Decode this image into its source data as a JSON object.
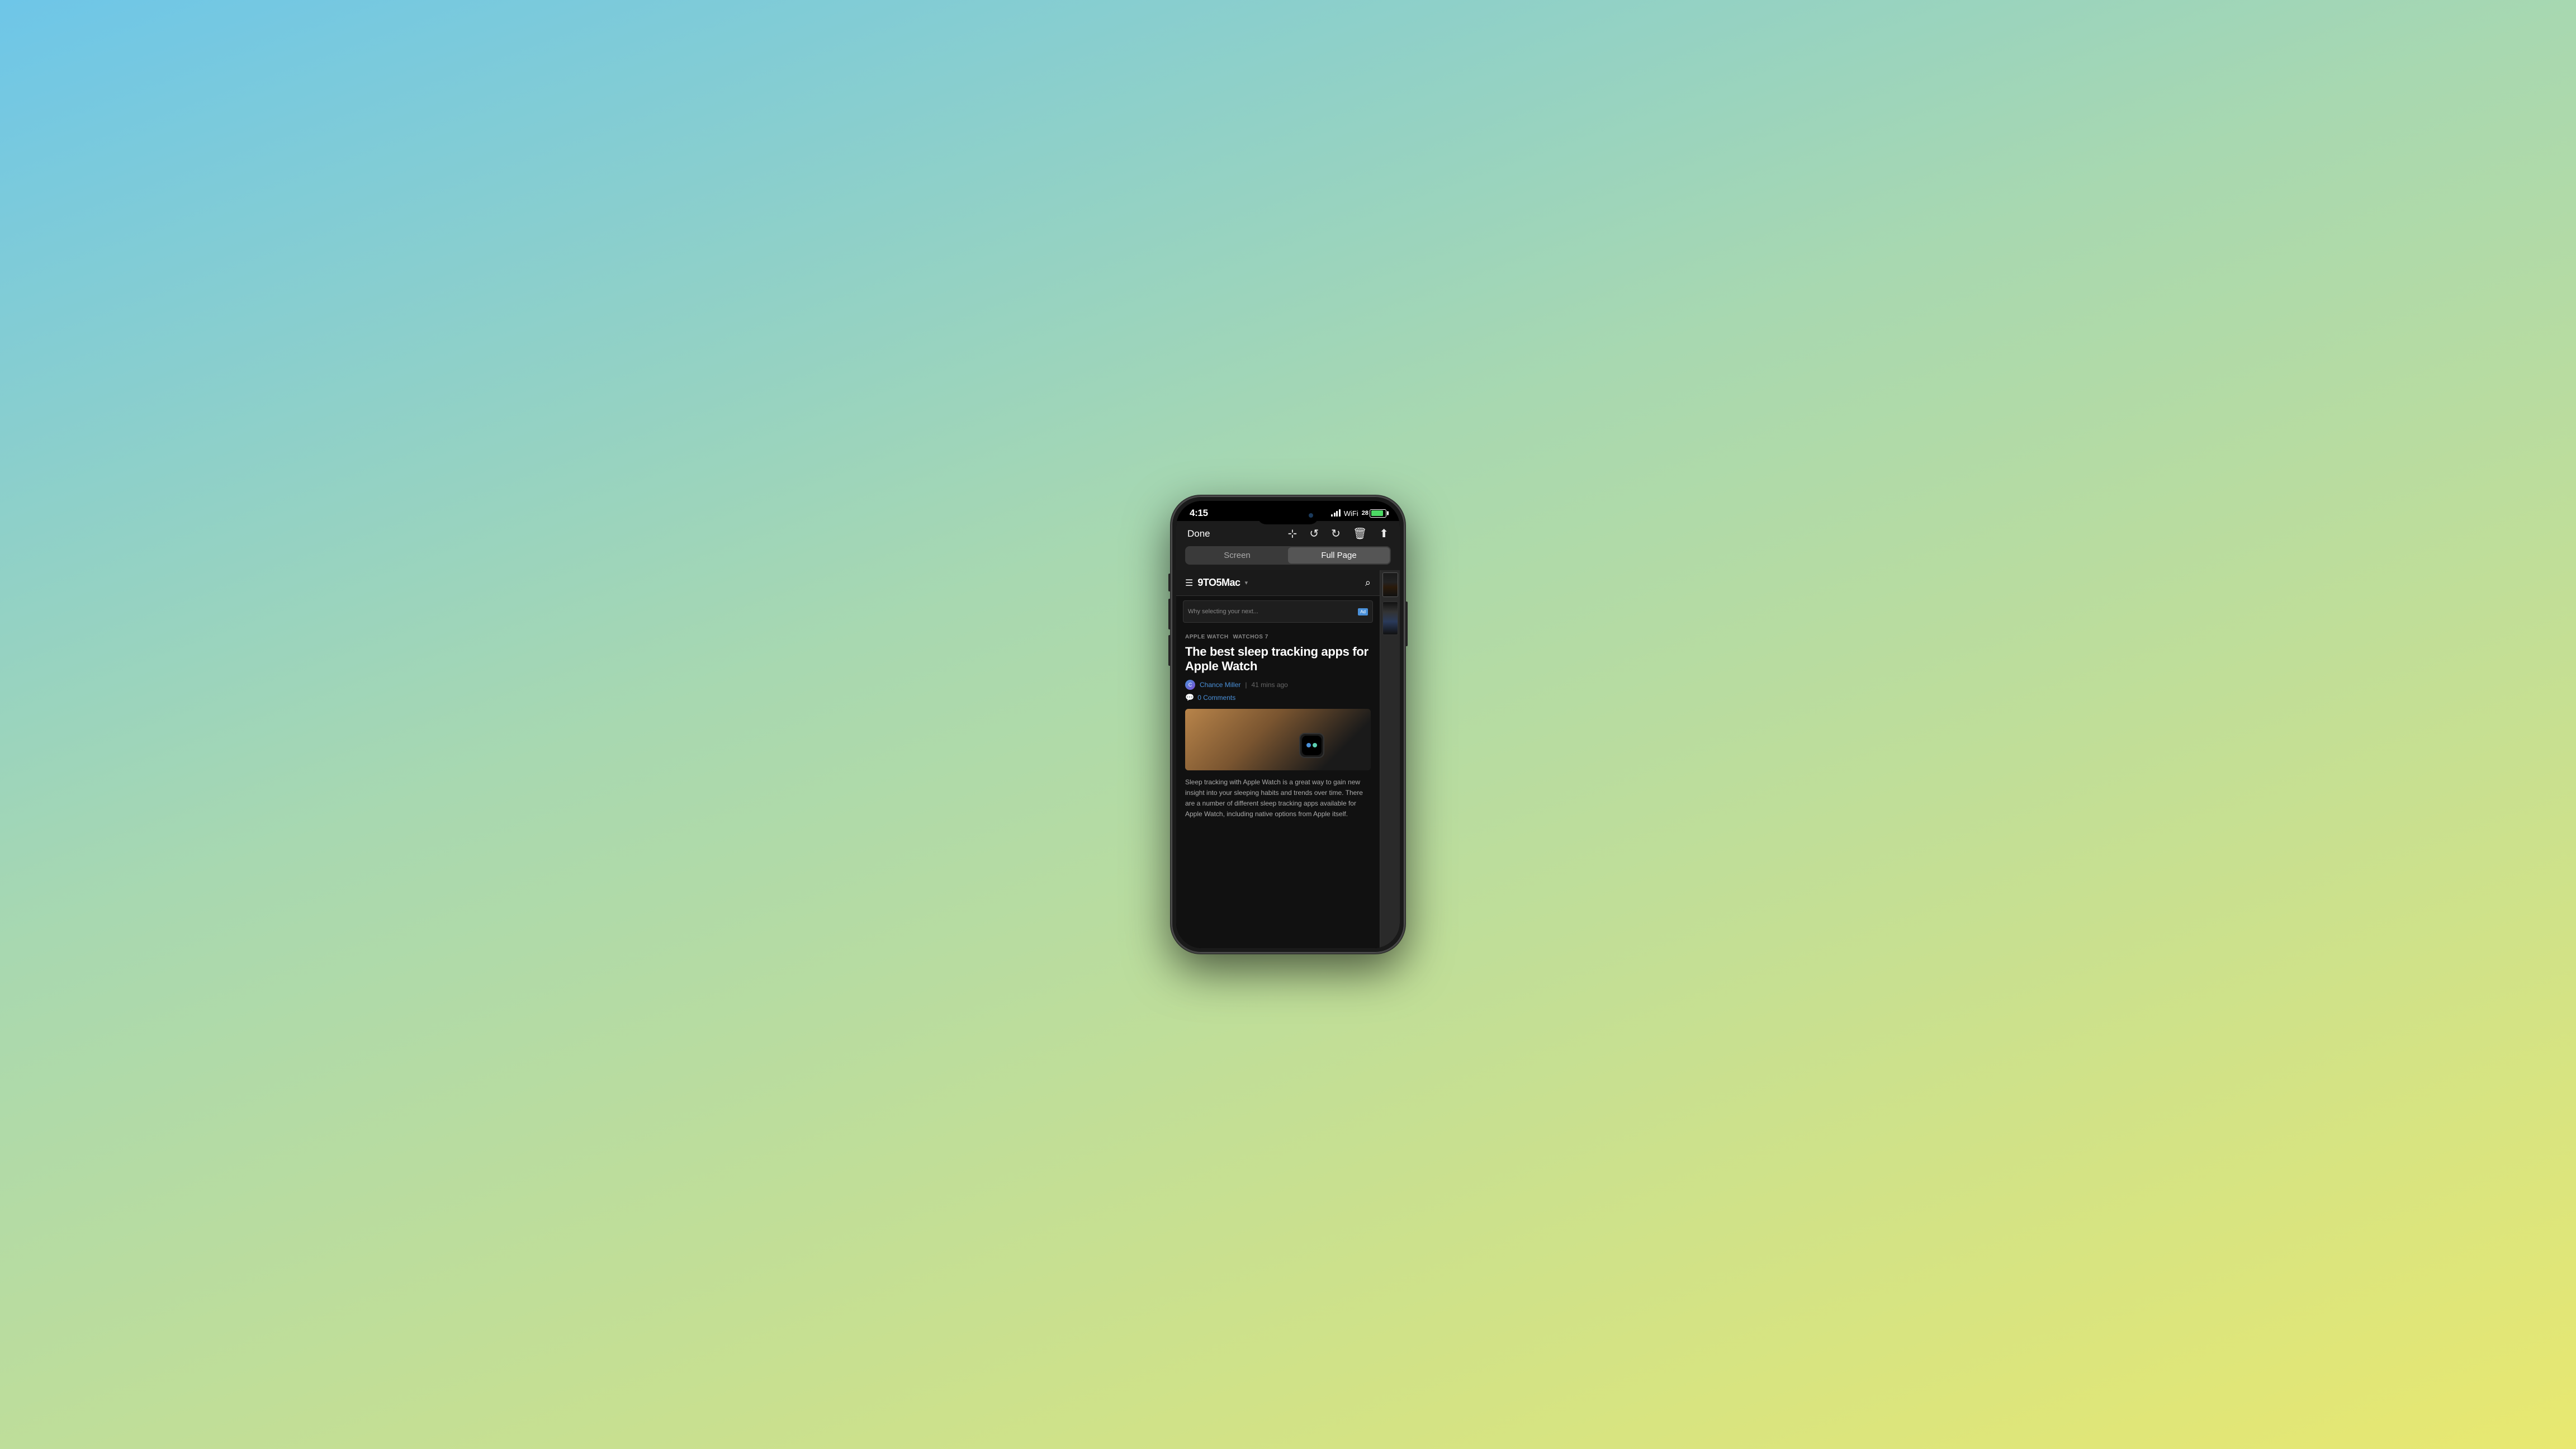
{
  "status_bar": {
    "time": "4:15",
    "battery_pct": "28"
  },
  "toolbar": {
    "done_label": "Done",
    "icons": {
      "crop": "⊞",
      "rotate_left": "↺",
      "rotate_right": "↻",
      "delete": "🗑",
      "share": "⬆"
    }
  },
  "segment": {
    "screen_label": "Screen",
    "full_page_label": "Full Page",
    "active": "full_page"
  },
  "site": {
    "logo": "9TO5Mac",
    "dropdown_arrow": "▾",
    "categories": [
      "APPLE WATCH",
      "WATCHOS 7"
    ],
    "article_title": "The best sleep tracking apps for Apple Watch",
    "author": "Chance Miller",
    "time_ago": "41 mins ago",
    "comments": "0 Comments",
    "body_text": "Sleep tracking with Apple Watch is a great way to gain new insight into your sleeping habits and trends over time. There are a number of different sleep tracking apps available for Apple Watch, including native options from Apple itself."
  }
}
